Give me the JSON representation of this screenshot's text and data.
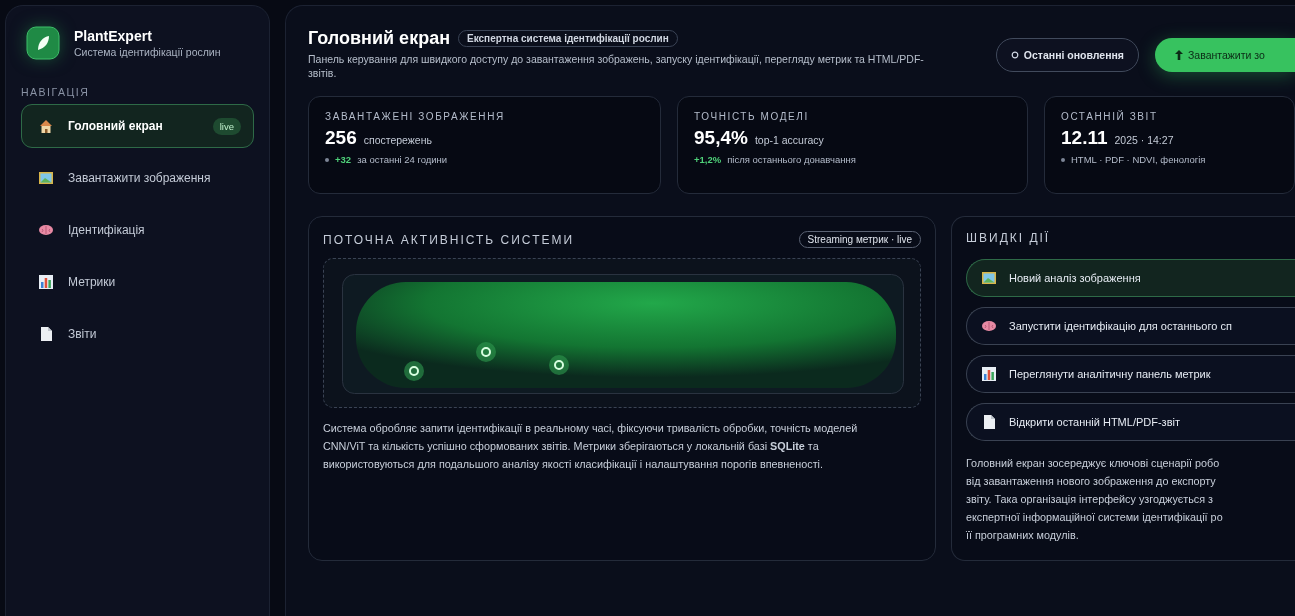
{
  "app": {
    "name": "PlantExpert",
    "subtitle": "Система ідентифікації рослин"
  },
  "sidebar": {
    "heading": "НАВІГАЦІЯ",
    "items": [
      {
        "label": "Головний екран",
        "selected": true,
        "badge": "live"
      },
      {
        "label": "Завантажити зображення",
        "selected": false
      },
      {
        "label": "Ідентифікація",
        "selected": false
      },
      {
        "label": "Метрики",
        "selected": false
      },
      {
        "label": "Звіти",
        "selected": false
      }
    ]
  },
  "header": {
    "title": "Головний екран",
    "tag": "Експертна система ідентифікації рослин",
    "description": "Панель керування для швидкого доступу до завантаження зображень, запуску ідентифікації, перегляду метрик та HTML/PDF-звітів.",
    "buttons": [
      {
        "label": "Останні оновлення",
        "kind": "outline"
      },
      {
        "label": "Завантажити зо",
        "kind": "primary"
      }
    ]
  },
  "stats": [
    {
      "label": "ЗАВАНТАЖЕНІ ЗОБРАЖЕННЯ",
      "value": "256",
      "unit": "спостережень",
      "bullet": true,
      "delta": "+32",
      "note": "за останні 24 години"
    },
    {
      "label": "ТОЧНІСТЬ МОДЕЛІ",
      "value": "95,4%",
      "unit": "top-1 accuracy",
      "bullet": false,
      "delta": "+1,2%",
      "note": "після останнього донавчання"
    },
    {
      "label": "ОСТАННІЙ ЗВІТ",
      "value": "12.11",
      "unit": "2025 · 14:27",
      "bullet": true,
      "note": "HTML · PDF · NDVI, фенологія"
    }
  ],
  "activity": {
    "title": "ПОТОЧНА АКТИВНІСТЬ СИСТЕМИ",
    "badge": "Streaming метрик · live",
    "text": "Система обробляє запити ідентифікації в реальному часі, фіксуючи тривалість обробки, точність моделей CNN/ViT та кількість успішно сформованих звітів. Метрики зберігаються у локальній базі **SQLite** та використовуються для подальшого аналізу якості класифікації і налаштування порогів впевненості."
  },
  "quick_actions": {
    "title": "ШВИДКІ ДІЇ",
    "items": [
      {
        "label": "Новий аналіз зображення",
        "selected": true
      },
      {
        "label": "Запустити ідентифікацію для останнього сп",
        "selected": false
      },
      {
        "label": "Переглянути аналітичну панель метрик",
        "selected": false
      },
      {
        "label": "Відкрити останній HTML/PDF-звіт",
        "selected": false
      }
    ],
    "text_lines": [
      "Головний екран зосереджує ключові сценарії робо",
      "від завантаження нового зображення до експорту",
      "звіту. Така організація інтерфейсу узгоджується з",
      "експертної інформаційної системи ідентифікації ро",
      "її програмних модулів."
    ]
  }
}
